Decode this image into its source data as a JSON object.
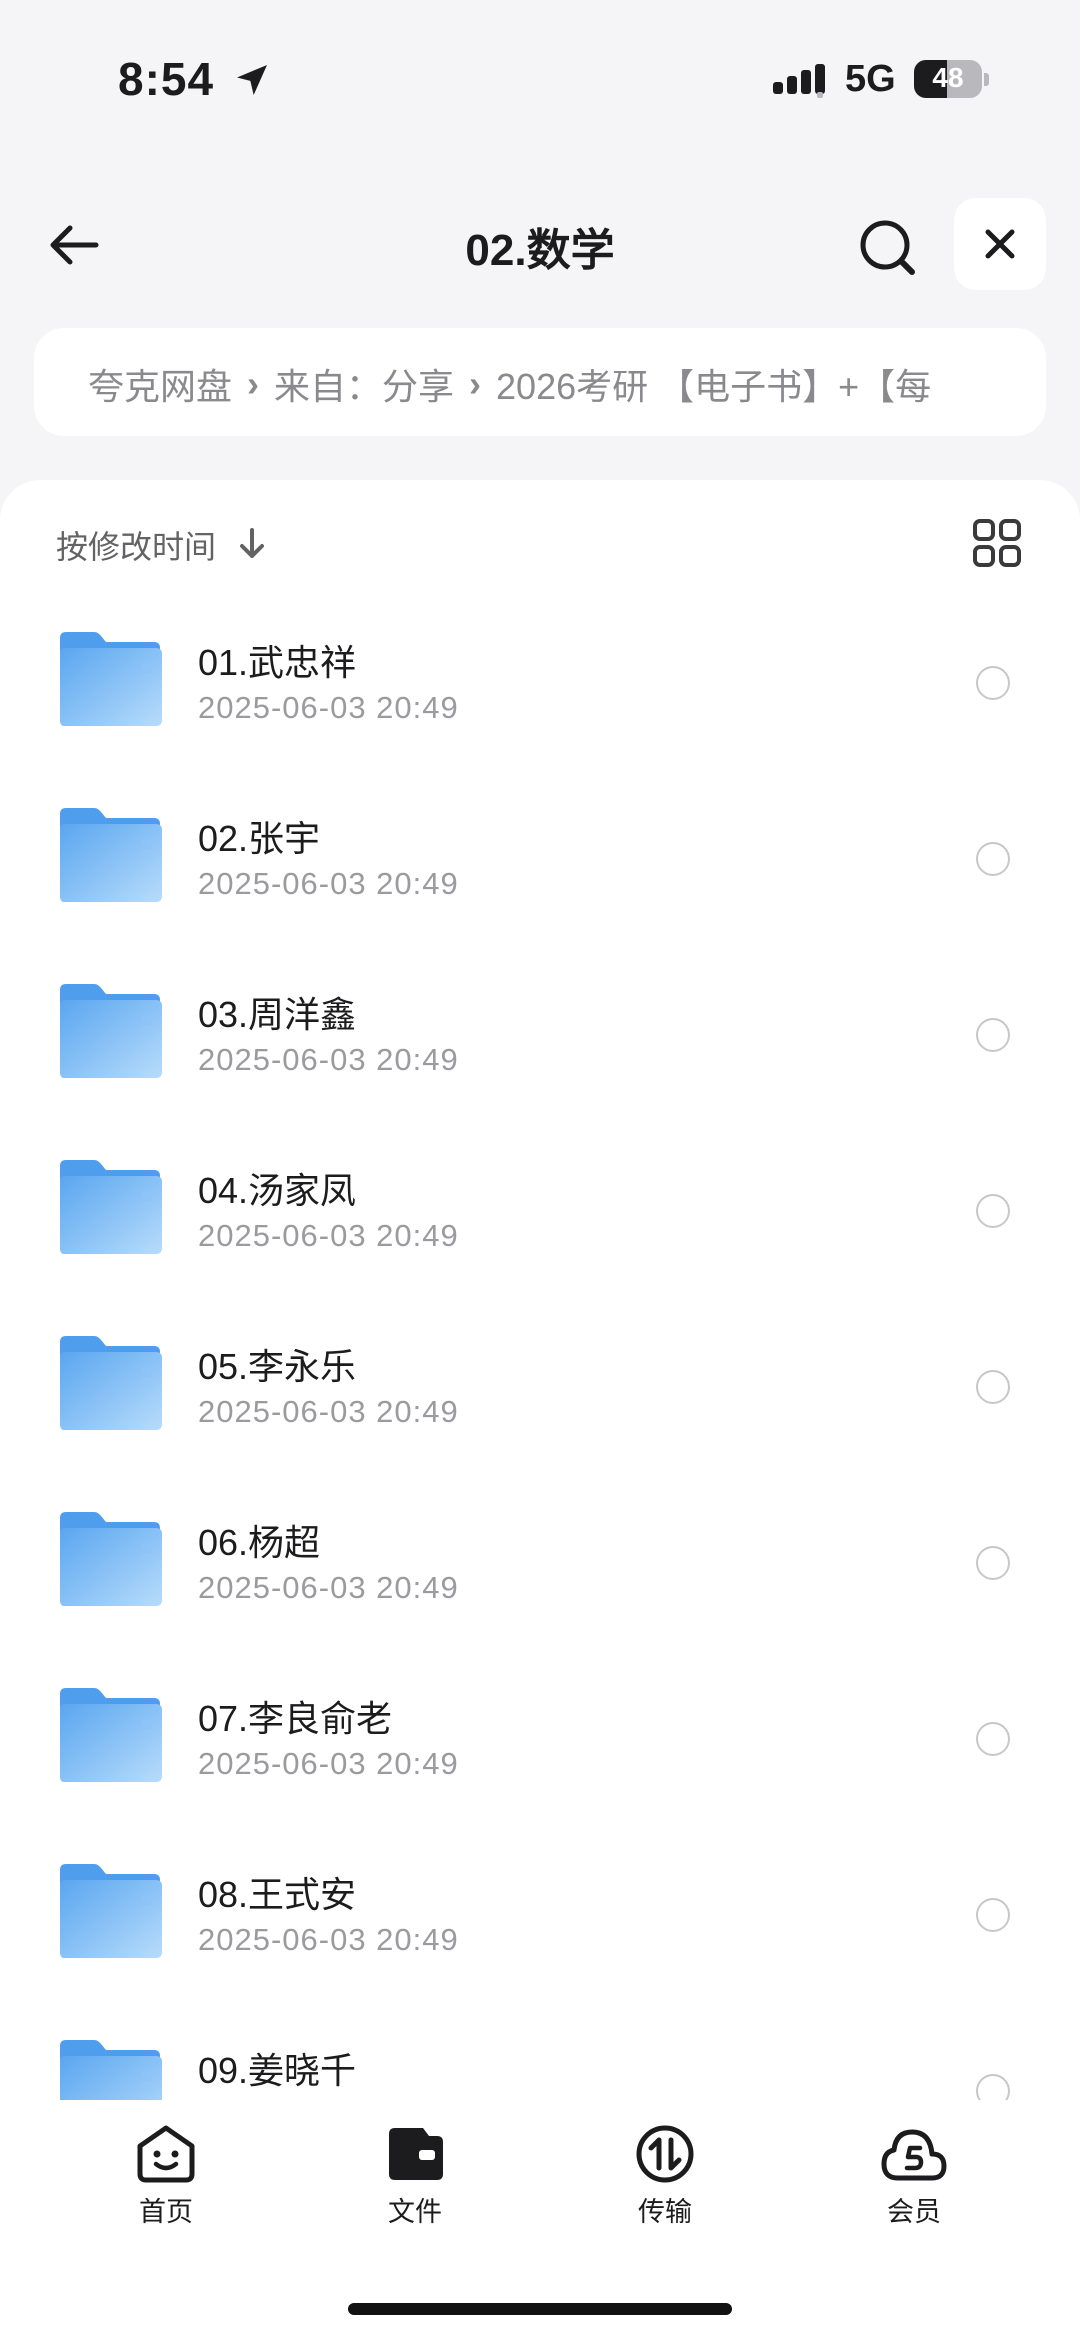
{
  "status_bar": {
    "time": "8:54",
    "network": "5G",
    "battery": "48",
    "battery_level": 0.48
  },
  "header": {
    "title": "02.数学"
  },
  "breadcrumb": {
    "items": [
      "夸克网盘",
      "来自：分享",
      "2026考研 【电子书】+【每"
    ]
  },
  "sort": {
    "label": "按修改时间"
  },
  "files": [
    {
      "name": "01.武忠祥",
      "date": "2025-06-03 20:49"
    },
    {
      "name": "02.张宇",
      "date": "2025-06-03 20:49"
    },
    {
      "name": "03.周洋鑫",
      "date": "2025-06-03 20:49"
    },
    {
      "name": "04.汤家凤",
      "date": "2025-06-03 20:49"
    },
    {
      "name": "05.李永乐",
      "date": "2025-06-03 20:49"
    },
    {
      "name": "06.杨超",
      "date": "2025-06-03 20:49"
    },
    {
      "name": "07.李良俞老",
      "date": "2025-06-03 20:49"
    },
    {
      "name": "08.王式安",
      "date": "2025-06-03 20:49"
    },
    {
      "name": "09.姜晓千",
      "date": ""
    }
  ],
  "tabbar": {
    "tabs": [
      {
        "label": "首页",
        "icon": "smiley-icon"
      },
      {
        "label": "文件",
        "icon": "wallet-icon"
      },
      {
        "label": "传输",
        "icon": "transfer-icon"
      },
      {
        "label": "会员",
        "icon": "cloud-icon"
      }
    ]
  },
  "colors": {
    "folder": "#6fb4f5",
    "accent": "#1c1c1e",
    "background": "#f5f5f7"
  }
}
